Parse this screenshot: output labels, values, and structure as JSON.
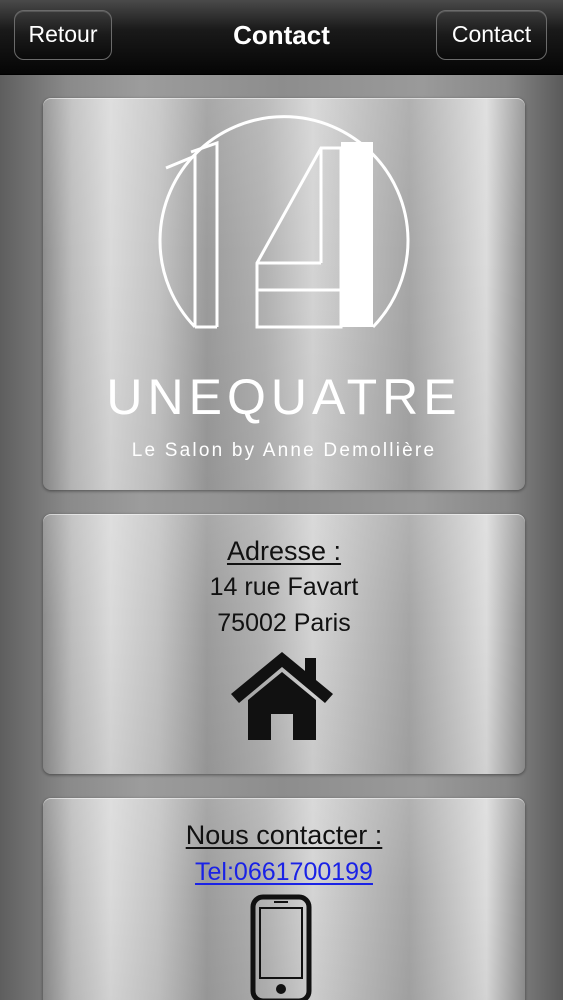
{
  "navbar": {
    "back_label": "Retour",
    "title": "Contact",
    "contact_label": "Contact"
  },
  "brand": {
    "logo_mark": "14",
    "name": "UNEQUATRE",
    "tagline": "Le Salon by Anne Demollière"
  },
  "address": {
    "heading": "Adresse :",
    "street": "14 rue Favart",
    "city": "75002 Paris",
    "icon": "home-icon"
  },
  "contact": {
    "heading": "Nous contacter :",
    "phone_link": "Tel:0661700199",
    "icon": "smartphone-icon"
  },
  "colors": {
    "link": "#1a22e6",
    "navbar": "#0a0a0a",
    "text": "#111111"
  }
}
